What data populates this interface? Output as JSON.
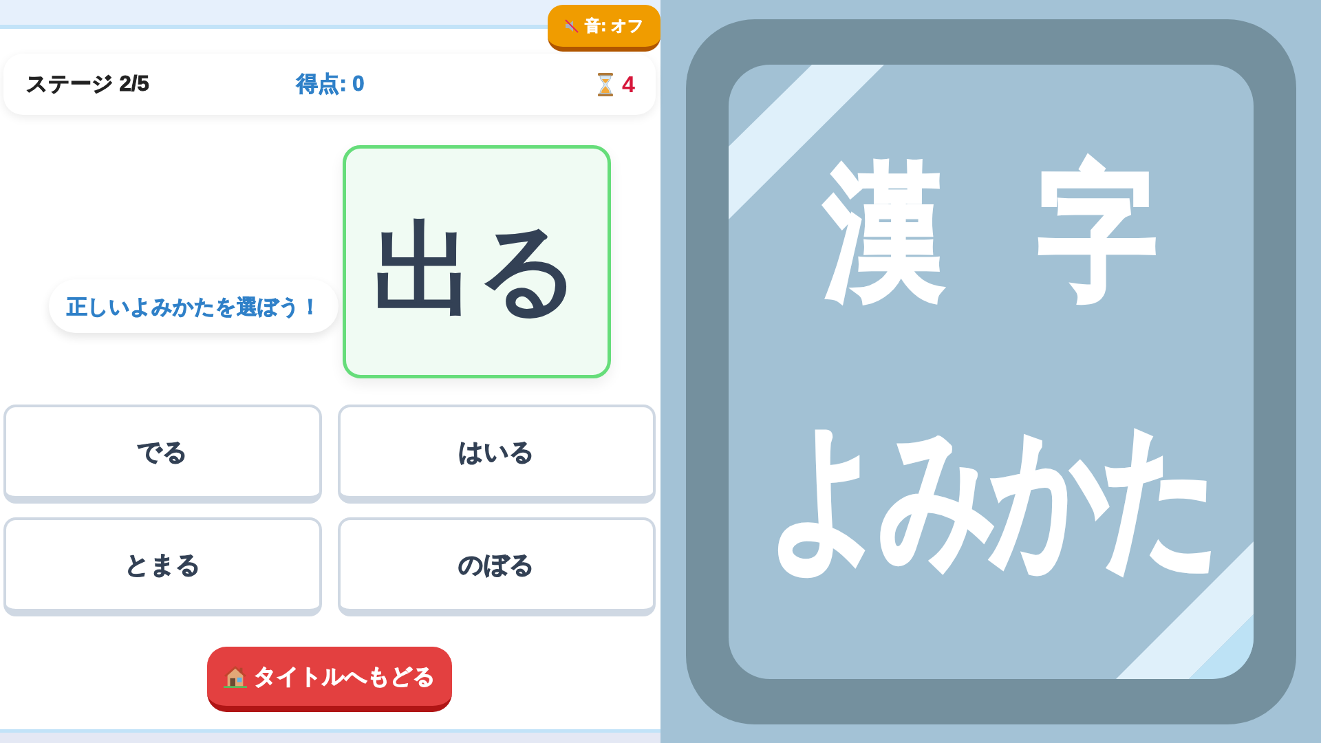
{
  "sound_button": {
    "label": "音: オフ",
    "muted": true
  },
  "status": {
    "stage": "ステージ 2/5",
    "score": "得点: 0",
    "timer": "4"
  },
  "prompt": "正しいよみかたを選ぼう！",
  "question_card": {
    "text": "出る"
  },
  "choices": [
    {
      "label": "でる",
      "selected": false
    },
    {
      "label": "はいる",
      "selected": false
    },
    {
      "label": "とまる",
      "selected": false
    },
    {
      "label": "のぼる",
      "selected": false
    }
  ],
  "back_button": {
    "label": "タイトルへもどる"
  },
  "title_card": {
    "line_1": "漢 字",
    "line_2": "よみかた"
  }
}
